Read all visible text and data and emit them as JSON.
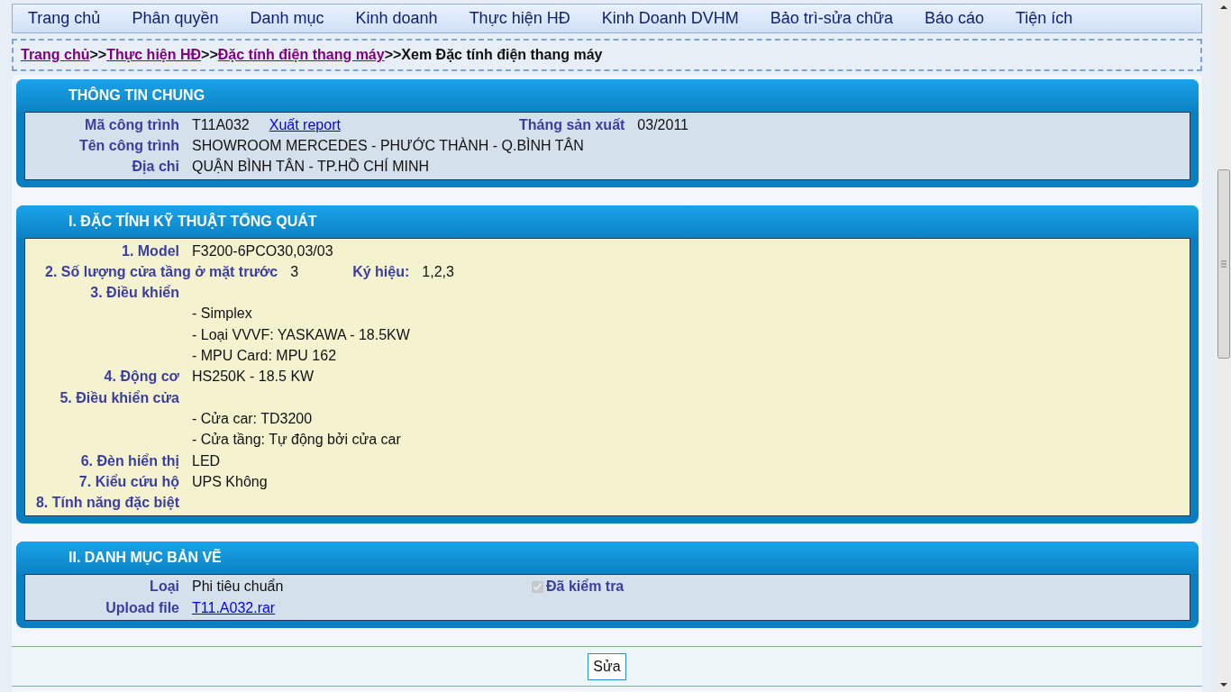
{
  "menu": [
    {
      "label": "Trang chủ"
    },
    {
      "label": "Phân quyền"
    },
    {
      "label": "Danh mục"
    },
    {
      "label": "Kinh doanh"
    },
    {
      "label": "Thực hiện HĐ"
    },
    {
      "label": "Kinh Doanh DVHM"
    },
    {
      "label": "Bảo trì-sửa chữa"
    },
    {
      "label": "Báo cáo"
    },
    {
      "label": "Tiện ích"
    }
  ],
  "breadcrumb": {
    "links": [
      "Trang chủ",
      "Thực hiện HĐ",
      "Đặc tính điện thang máy"
    ],
    "separator": ">>",
    "current": "Xem Đặc tính điện thang máy"
  },
  "sections": [
    {
      "title": "THÔNG TIN CHUNG",
      "kind": "info",
      "rows": [
        {
          "items": [
            {
              "kind": "label",
              "text": "Mã công trình"
            },
            {
              "kind": "value",
              "text": "T11A032"
            },
            {
              "kind": "link",
              "text": "Xuất report"
            }
          ],
          "aside": [
            {
              "kind": "label-inline",
              "text": "Tháng sản xuất"
            },
            {
              "kind": "value",
              "text": "03/2011"
            }
          ]
        },
        {
          "items": [
            {
              "kind": "label",
              "text": "Tên công trình"
            },
            {
              "kind": "value",
              "text": "SHOWROOM MERCEDES - PHƯỚC THÀNH - Q.BÌNH TÂN"
            }
          ]
        },
        {
          "items": [
            {
              "kind": "label",
              "text": "Địa chỉ"
            },
            {
              "kind": "value",
              "text": "QUẬN BÌNH TÂN - TP.HỒ CHÍ MINH"
            }
          ]
        }
      ]
    },
    {
      "title": "I. ĐẶC TÍNH KỸ THUẬT TỔNG QUÁT",
      "kind": "spec",
      "rows": [
        {
          "items": [
            {
              "kind": "label",
              "text": "1. Model"
            },
            {
              "kind": "value",
              "text": "F3200-6PCO30,03/03"
            }
          ]
        },
        {
          "items": [
            {
              "kind": "label-wide",
              "text": "2. Số lượng cửa tầng ở mặt trước"
            },
            {
              "kind": "value",
              "text": "3"
            },
            {
              "kind": "label-spaced",
              "text": "Ký hiệu:"
            },
            {
              "kind": "value",
              "text": "1,2,3"
            }
          ]
        },
        {
          "items": [
            {
              "kind": "label",
              "text": "3. Điều khiển"
            }
          ]
        },
        {
          "items": [
            {
              "kind": "blank"
            },
            {
              "kind": "value",
              "text": "- Simplex"
            }
          ]
        },
        {
          "items": [
            {
              "kind": "blank"
            },
            {
              "kind": "value",
              "text": "- Loại VVVF:  YASKAWA - 18.5KW"
            }
          ]
        },
        {
          "items": [
            {
              "kind": "blank"
            },
            {
              "kind": "value",
              "text": "- MPU Card: MPU 162"
            }
          ]
        },
        {
          "items": [
            {
              "kind": "label",
              "text": "4. Động cơ"
            },
            {
              "kind": "value",
              "text": "HS250K - 18.5 KW"
            }
          ]
        },
        {
          "items": [
            {
              "kind": "label",
              "text": "5. Điều khiển cửa"
            }
          ]
        },
        {
          "items": [
            {
              "kind": "blank"
            },
            {
              "kind": "value",
              "text": "- Cửa car: TD3200"
            }
          ]
        },
        {
          "items": [
            {
              "kind": "blank"
            },
            {
              "kind": "value",
              "text": "- Cửa tầng: Tự động bởi cửa car"
            }
          ]
        },
        {
          "items": [
            {
              "kind": "label",
              "text": "6. Đèn hiển thị"
            },
            {
              "kind": "value",
              "text": "LED"
            }
          ]
        },
        {
          "items": [
            {
              "kind": "label",
              "text": "7. Kiểu cứu hộ"
            },
            {
              "kind": "value",
              "text": "UPS Không"
            }
          ]
        },
        {
          "items": [
            {
              "kind": "label",
              "text": "8. Tính năng đặc biệt"
            }
          ]
        }
      ]
    },
    {
      "title": "II. DANH MỤC BẢN VẼ",
      "kind": "info",
      "rows": [
        {
          "items": [
            {
              "kind": "label",
              "text": "Loại"
            },
            {
              "kind": "value",
              "text": "Phi tiêu chuẩn"
            }
          ],
          "aside": [
            {
              "kind": "checkbox",
              "text": "Đã kiểm tra",
              "checked": true,
              "disabled": true
            }
          ]
        },
        {
          "items": [
            {
              "kind": "label",
              "text": "Upload file"
            },
            {
              "kind": "file-link",
              "text": "T11.A032.rar"
            }
          ]
        }
      ]
    }
  ],
  "footer": {
    "button": "Sửa"
  }
}
